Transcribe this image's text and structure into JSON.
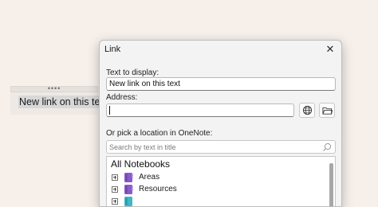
{
  "note": {
    "handle_dots": "••••",
    "text": "New link on this text"
  },
  "dialog": {
    "title": "Link",
    "close_glyph": "✕",
    "text_to_display": {
      "label": "Text to display:",
      "value": "New link on this text"
    },
    "address": {
      "label": "Address:",
      "value": ""
    },
    "browse_web_icon": "globe-icon",
    "browse_file_icon": "folder-icon",
    "pick_location": {
      "label": "Or pick a location in OneNote:",
      "search_placeholder": "Search by text in title"
    },
    "tree": {
      "root": "All Notebooks",
      "items": [
        {
          "label": "Areas",
          "icon": "notebook-icon",
          "color": "#8a5ac7"
        },
        {
          "label": "Resources",
          "icon": "notebook-icon",
          "color": "#8a5ac7"
        },
        {
          "label": "",
          "icon": "notebook-icon",
          "color": "#3fb6c9"
        }
      ]
    }
  }
}
